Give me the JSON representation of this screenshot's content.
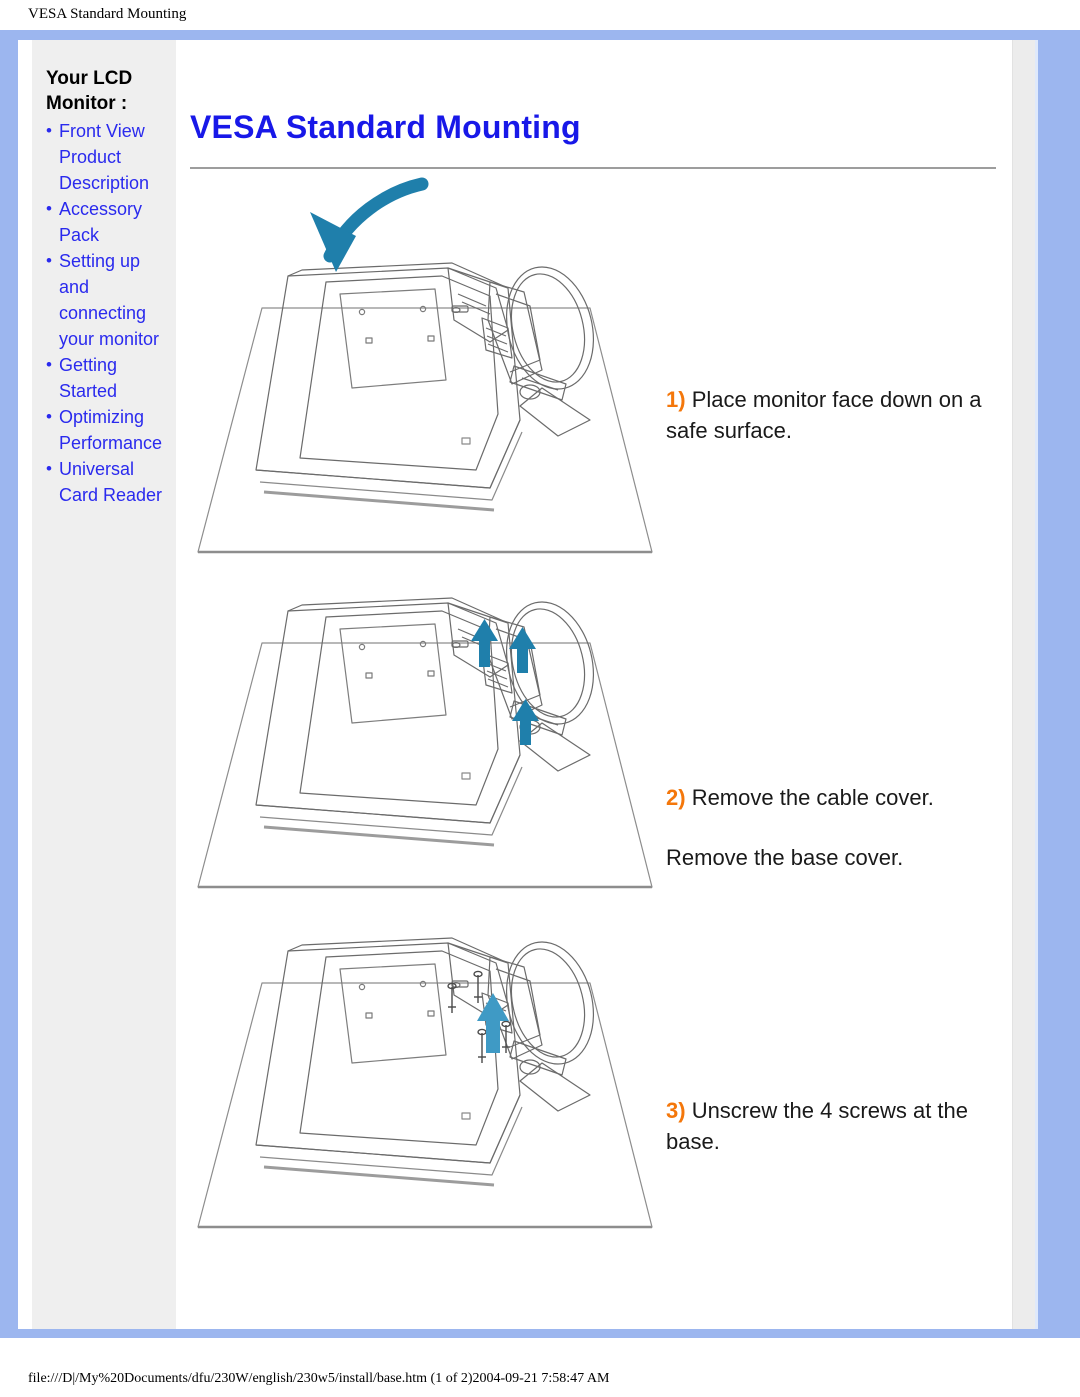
{
  "browser": {
    "header_title": "VESA Standard Mounting",
    "footer_path": "file:///D|/My%20Documents/dfu/230W/english/230w5/install/base.htm (1 of 2)2004-09-21 7:58:47 AM"
  },
  "sidebar": {
    "title": "Your LCD Monitor :",
    "items": [
      {
        "label": "Front View Product Description"
      },
      {
        "label": "Accessory Pack"
      },
      {
        "label": "Setting up and connecting your monitor"
      },
      {
        "label": "Getting Started"
      },
      {
        "label": "Optimizing Performance"
      },
      {
        "label": "Universal Card Reader"
      }
    ]
  },
  "main": {
    "title": "VESA Standard Mounting",
    "steps": [
      {
        "number": "1)",
        "text": "Place monitor face down on a safe surface.",
        "sub_text": "",
        "figure_name": "monitor-face-down-illustration"
      },
      {
        "number": "2)",
        "text": "Remove the cable cover.",
        "sub_text": "Remove the base cover.",
        "figure_name": "remove-cable-cover-illustration"
      },
      {
        "number": "3)",
        "text": "Unscrew the 4 screws at the base.",
        "sub_text": "",
        "figure_name": "unscrew-base-screws-illustration"
      }
    ]
  },
  "colors": {
    "page_border": "#9cb6ef",
    "title_blue": "#1818e8",
    "link_blue": "#2a2aee",
    "step_number_orange": "#f4770b",
    "arrow_blue": "#1f7fab",
    "sidebar_gray": "#efefef",
    "line_art": "#5a5a5a"
  }
}
